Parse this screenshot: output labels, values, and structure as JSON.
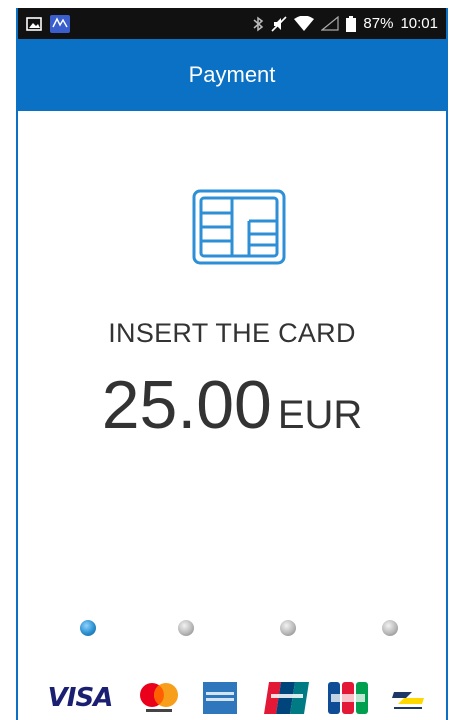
{
  "status_bar": {
    "battery_percent": "87%",
    "time": "10:01",
    "icons": [
      "image-icon",
      "app-icon",
      "bluetooth-icon",
      "mute-icon",
      "wifi-icon",
      "signal-icon",
      "battery-icon"
    ]
  },
  "header": {
    "title": "Payment",
    "color": "#0a71c4"
  },
  "main": {
    "card_icon": "chip-card-icon",
    "instruction": "INSERT THE CARD",
    "amount": "25.00",
    "currency": "EUR"
  },
  "progress": {
    "steps": 4,
    "active_step": 1
  },
  "card_brands": [
    {
      "name": "visa-logo",
      "label": "VISA"
    },
    {
      "name": "mastercard-logo",
      "label": "mastercard"
    },
    {
      "name": "amex-logo",
      "label": "AMERICAN EXPRESS"
    },
    {
      "name": "unionpay-logo",
      "label": "UnionPay"
    },
    {
      "name": "jcb-logo",
      "label": "JCB"
    },
    {
      "name": "bancontact-logo",
      "label": "Bancontact"
    }
  ]
}
